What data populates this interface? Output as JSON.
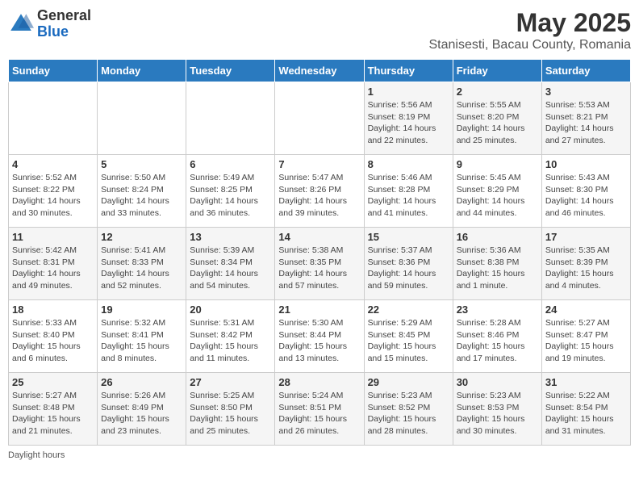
{
  "header": {
    "logo_general": "General",
    "logo_blue": "Blue",
    "title": "May 2025",
    "subtitle": "Stanisesti, Bacau County, Romania"
  },
  "calendar": {
    "days_of_week": [
      "Sunday",
      "Monday",
      "Tuesday",
      "Wednesday",
      "Thursday",
      "Friday",
      "Saturday"
    ],
    "weeks": [
      [
        {
          "day": "",
          "info": ""
        },
        {
          "day": "",
          "info": ""
        },
        {
          "day": "",
          "info": ""
        },
        {
          "day": "",
          "info": ""
        },
        {
          "day": "1",
          "info": "Sunrise: 5:56 AM\nSunset: 8:19 PM\nDaylight: 14 hours\nand 22 minutes."
        },
        {
          "day": "2",
          "info": "Sunrise: 5:55 AM\nSunset: 8:20 PM\nDaylight: 14 hours\nand 25 minutes."
        },
        {
          "day": "3",
          "info": "Sunrise: 5:53 AM\nSunset: 8:21 PM\nDaylight: 14 hours\nand 27 minutes."
        }
      ],
      [
        {
          "day": "4",
          "info": "Sunrise: 5:52 AM\nSunset: 8:22 PM\nDaylight: 14 hours\nand 30 minutes."
        },
        {
          "day": "5",
          "info": "Sunrise: 5:50 AM\nSunset: 8:24 PM\nDaylight: 14 hours\nand 33 minutes."
        },
        {
          "day": "6",
          "info": "Sunrise: 5:49 AM\nSunset: 8:25 PM\nDaylight: 14 hours\nand 36 minutes."
        },
        {
          "day": "7",
          "info": "Sunrise: 5:47 AM\nSunset: 8:26 PM\nDaylight: 14 hours\nand 39 minutes."
        },
        {
          "day": "8",
          "info": "Sunrise: 5:46 AM\nSunset: 8:28 PM\nDaylight: 14 hours\nand 41 minutes."
        },
        {
          "day": "9",
          "info": "Sunrise: 5:45 AM\nSunset: 8:29 PM\nDaylight: 14 hours\nand 44 minutes."
        },
        {
          "day": "10",
          "info": "Sunrise: 5:43 AM\nSunset: 8:30 PM\nDaylight: 14 hours\nand 46 minutes."
        }
      ],
      [
        {
          "day": "11",
          "info": "Sunrise: 5:42 AM\nSunset: 8:31 PM\nDaylight: 14 hours\nand 49 minutes."
        },
        {
          "day": "12",
          "info": "Sunrise: 5:41 AM\nSunset: 8:33 PM\nDaylight: 14 hours\nand 52 minutes."
        },
        {
          "day": "13",
          "info": "Sunrise: 5:39 AM\nSunset: 8:34 PM\nDaylight: 14 hours\nand 54 minutes."
        },
        {
          "day": "14",
          "info": "Sunrise: 5:38 AM\nSunset: 8:35 PM\nDaylight: 14 hours\nand 57 minutes."
        },
        {
          "day": "15",
          "info": "Sunrise: 5:37 AM\nSunset: 8:36 PM\nDaylight: 14 hours\nand 59 minutes."
        },
        {
          "day": "16",
          "info": "Sunrise: 5:36 AM\nSunset: 8:38 PM\nDaylight: 15 hours\nand 1 minute."
        },
        {
          "day": "17",
          "info": "Sunrise: 5:35 AM\nSunset: 8:39 PM\nDaylight: 15 hours\nand 4 minutes."
        }
      ],
      [
        {
          "day": "18",
          "info": "Sunrise: 5:33 AM\nSunset: 8:40 PM\nDaylight: 15 hours\nand 6 minutes."
        },
        {
          "day": "19",
          "info": "Sunrise: 5:32 AM\nSunset: 8:41 PM\nDaylight: 15 hours\nand 8 minutes."
        },
        {
          "day": "20",
          "info": "Sunrise: 5:31 AM\nSunset: 8:42 PM\nDaylight: 15 hours\nand 11 minutes."
        },
        {
          "day": "21",
          "info": "Sunrise: 5:30 AM\nSunset: 8:44 PM\nDaylight: 15 hours\nand 13 minutes."
        },
        {
          "day": "22",
          "info": "Sunrise: 5:29 AM\nSunset: 8:45 PM\nDaylight: 15 hours\nand 15 minutes."
        },
        {
          "day": "23",
          "info": "Sunrise: 5:28 AM\nSunset: 8:46 PM\nDaylight: 15 hours\nand 17 minutes."
        },
        {
          "day": "24",
          "info": "Sunrise: 5:27 AM\nSunset: 8:47 PM\nDaylight: 15 hours\nand 19 minutes."
        }
      ],
      [
        {
          "day": "25",
          "info": "Sunrise: 5:27 AM\nSunset: 8:48 PM\nDaylight: 15 hours\nand 21 minutes."
        },
        {
          "day": "26",
          "info": "Sunrise: 5:26 AM\nSunset: 8:49 PM\nDaylight: 15 hours\nand 23 minutes."
        },
        {
          "day": "27",
          "info": "Sunrise: 5:25 AM\nSunset: 8:50 PM\nDaylight: 15 hours\nand 25 minutes."
        },
        {
          "day": "28",
          "info": "Sunrise: 5:24 AM\nSunset: 8:51 PM\nDaylight: 15 hours\nand 26 minutes."
        },
        {
          "day": "29",
          "info": "Sunrise: 5:23 AM\nSunset: 8:52 PM\nDaylight: 15 hours\nand 28 minutes."
        },
        {
          "day": "30",
          "info": "Sunrise: 5:23 AM\nSunset: 8:53 PM\nDaylight: 15 hours\nand 30 minutes."
        },
        {
          "day": "31",
          "info": "Sunrise: 5:22 AM\nSunset: 8:54 PM\nDaylight: 15 hours\nand 31 minutes."
        }
      ]
    ]
  },
  "footer": {
    "note": "Daylight hours"
  }
}
